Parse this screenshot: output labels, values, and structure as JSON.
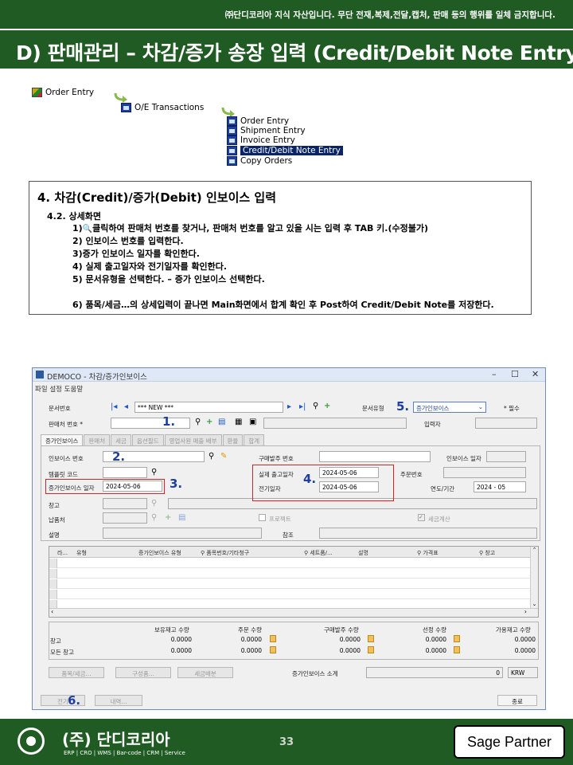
{
  "header": {
    "notice": "㈜단디코리아 지식 자산입니다. 무단 전재,복제,전달,캡처, 판매 등의 행위를 일체 금지합니다.",
    "title": "D) 판매관리 – 차감/증가 송장 입력 (Credit/Debit Note Entry)",
    "colors": {
      "brand": "#1f5b23"
    }
  },
  "menu_tree": {
    "root": "Order Entry",
    "group": "O/E Transactions",
    "items": [
      "Order Entry",
      "Shipment Entry",
      "Invoice Entry",
      "Credit/Debit Note Entry",
      "Copy Orders"
    ],
    "selected": "Credit/Debit Note Entry"
  },
  "instructions": {
    "title": "4. 차감(Credit)/증가(Debit) 인보이스 입력",
    "subtitle": "4.2. 상세화면",
    "line1_prefix": "1)",
    "line1_rest": "클릭하여 판매처 번호를 찾거나, 판매처 번호를 알고 있을 시는 입력 후 TAB 키.(수정불가)",
    "line2": "2) 인보이스 번호를 입력한다.",
    "line3": "3)증가 인보이스 일자를 확인한다.",
    "line4": "4) 실제 출고일자와 전기일자를 확인한다.",
    "line5": "5) 문서유형을 선택한다. – 증가 인보이스 선택한다.",
    "line6": "6) 품목/세금…의 상세입력이 끝나면 Main화면에서 합계 확인 후 Post하여 Credit/Debit Note를 저장한다."
  },
  "window": {
    "title": "DEMOCO - 차감/증가인보이스",
    "menu": "파일 설정 도움말",
    "doc_no_label": "문서번호",
    "doc_no_value": "*** NEW ***",
    "doc_type_label": "문서유형",
    "doc_type_value": "증가인보이스",
    "required_label": "필수",
    "customer_label": "판매처 번호 *",
    "entered_by_label": "입력자",
    "tabs": [
      "증가인보이스",
      "판매처",
      "세금",
      "옵션필드",
      "영업사원 매출 배부",
      "환율",
      "합계"
    ],
    "invoice_no_label": "인보이스 번호",
    "po_no_label": "구매발주 번호",
    "invoice_date_label": "인보이스 일자",
    "template_label": "템플릿 코드",
    "actual_ship_date_label": "실제 출고일자",
    "actual_ship_date": "2024-05-06",
    "order_no_label": "주문번호",
    "debit_date_label": "증가인보이스 일자",
    "debit_date": "2024-05-06",
    "posting_date_label": "전기일자",
    "posting_date": "2024-05-06",
    "year_period_label": "연도/기간",
    "year_period": "2024 - 05",
    "warehouse_label": "창고",
    "ship_to_label": "납품처",
    "prepaid_label": "프로젝트",
    "tax_calc_label": "세금계산",
    "description_label": "설명",
    "reference_label": "참조",
    "grid_headers": [
      "라...",
      "유형",
      "증가인보이스 유형",
      "품목번호/기타청구",
      "세트품/...",
      "설명",
      "가격표",
      "창고"
    ],
    "summary_headers": [
      "보유재고 수량",
      "주문 수량",
      "구매발주 수량",
      "선정 수량",
      "가용재고 수량"
    ],
    "row_warehouse": "창고",
    "row_all_warehouses": "모든 창고",
    "row_warehouse_values": [
      "0.0000",
      "0.0000",
      "0.0000",
      "0.0000",
      "0.0000"
    ],
    "row_all_values": [
      "0.0000",
      "0.0000",
      "0.0000",
      "0.0000",
      "0.0000"
    ],
    "btn_items_taxes": "품목/세금...",
    "btn_components": "구성품...",
    "btn_tax_distribution": "세금배분",
    "total_label": "증가인보이스 소계",
    "total_value": "0",
    "currency": "KRW",
    "btn_post": "전기",
    "btn_detail": "내역...",
    "btn_close": "종료"
  },
  "steps": [
    "1.",
    "2.",
    "3.",
    "4.",
    "5.",
    "6."
  ],
  "footer": {
    "company": "(주) 단디코리아",
    "services": "ERP | CRO | WMS | Bar-code | CRM | Service",
    "page": "33",
    "partner": "Sage Partner"
  }
}
